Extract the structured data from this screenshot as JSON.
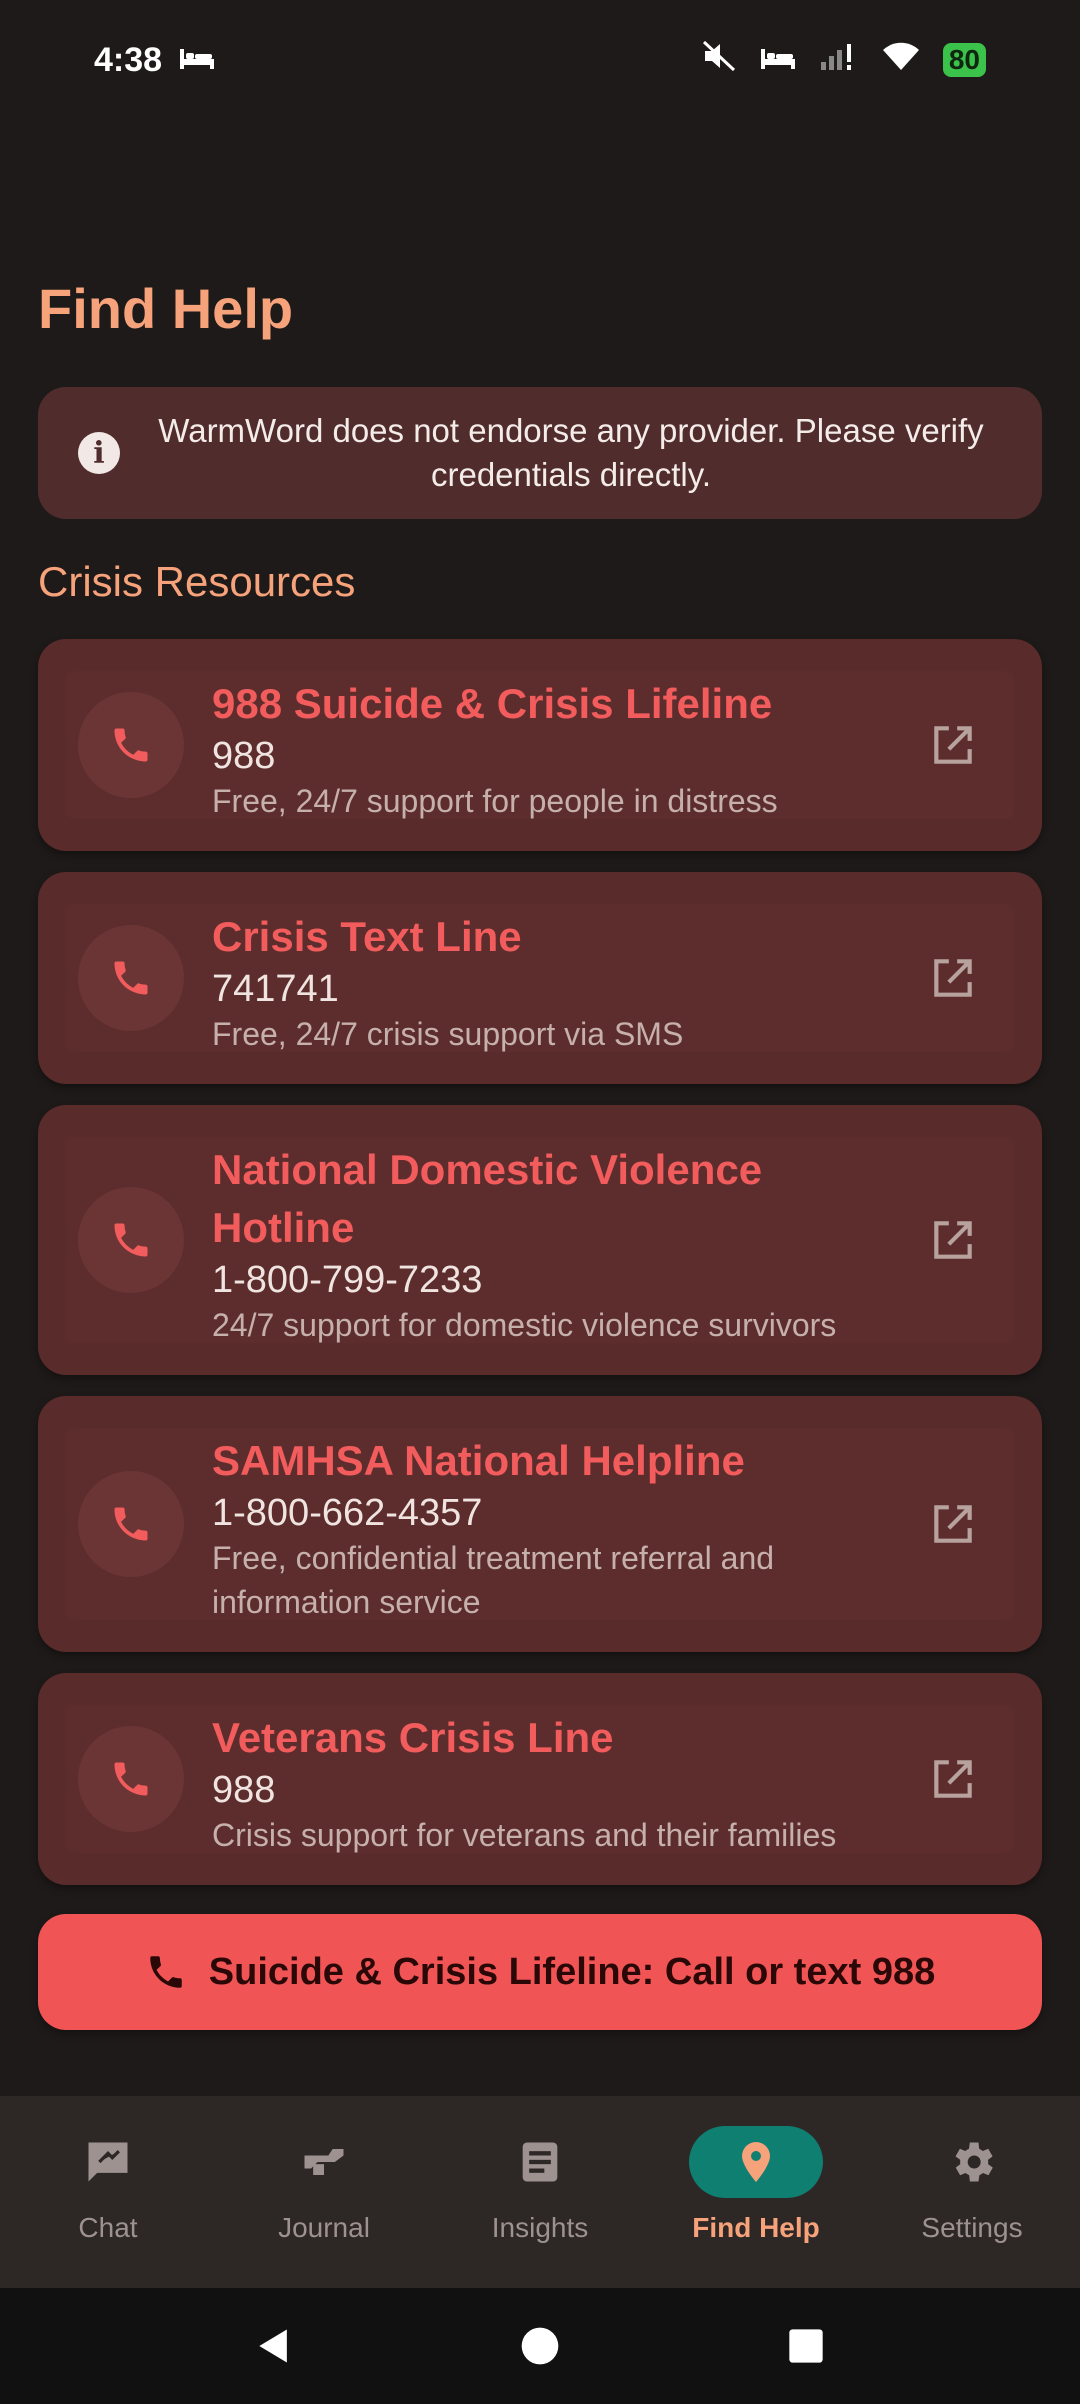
{
  "status_bar": {
    "time": "4:38",
    "battery": "80"
  },
  "page": {
    "title": "Find Help",
    "notice": "WarmWord does not endorse any provider. Please verify credentials directly.",
    "section_title": "Crisis Resources"
  },
  "resources": [
    {
      "name": "988 Suicide & Crisis Lifeline",
      "number": "988",
      "description": "Free, 24/7 support for people in distress"
    },
    {
      "name": "Crisis Text Line",
      "number": "741741",
      "description": "Free, 24/7 crisis support via SMS"
    },
    {
      "name": "National Domestic Violence Hotline",
      "number": "1-800-799-7233",
      "description": "24/7 support for domestic violence survivors"
    },
    {
      "name": "SAMHSA National Helpline",
      "number": "1-800-662-4357",
      "description": "Free, confidential treatment referral and information service"
    },
    {
      "name": "Veterans Crisis Line",
      "number": "988",
      "description": "Crisis support for veterans and their families"
    }
  ],
  "cta": {
    "label": "Suicide & Crisis Lifeline: Call or text 988"
  },
  "nav": {
    "items": [
      {
        "label": "Chat",
        "icon": "chat-icon"
      },
      {
        "label": "Journal",
        "icon": "journal-icon"
      },
      {
        "label": "Insights",
        "icon": "insights-icon"
      },
      {
        "label": "Find Help",
        "icon": "location-pin-icon"
      },
      {
        "label": "Settings",
        "icon": "gear-icon"
      }
    ],
    "active": "Find Help"
  },
  "colors": {
    "background": "#1e1a19",
    "accent": "#f6a27a",
    "card": "#5a2b2b",
    "danger": "#f05454",
    "nav_active": "#0f7f72"
  }
}
